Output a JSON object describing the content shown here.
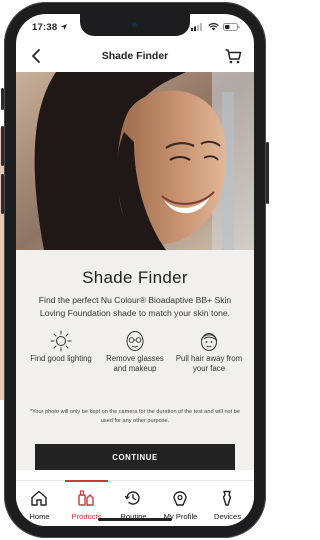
{
  "status_bar": {
    "time": "17:38",
    "location_icon": "location-arrow-icon",
    "signal_icon": "cellular-signal-icon",
    "wifi_icon": "wifi-icon",
    "battery_icon": "battery-icon"
  },
  "header": {
    "title": "Shade Finder",
    "back_icon": "back-chevron-icon",
    "cart_icon": "shopping-cart-icon"
  },
  "card": {
    "title": "Shade Finder",
    "description": "Find the perfect Nu Colour® Bioadaptive BB+ Skin Loving Foundation shade to match your skin tone.",
    "tips": [
      {
        "icon": "sun-icon",
        "label": "Find good lighting"
      },
      {
        "icon": "face-glasses-icon",
        "label": "Remove glasses and makeup"
      },
      {
        "icon": "face-hair-icon",
        "label": "Pull hair away from your face"
      }
    ],
    "privacy_note": "*Your photo will only be kept on the camera for the duration of the test and will not be used for any other purpose.",
    "cta_label": "CONTINUE"
  },
  "tab_bar": {
    "active_index": 1,
    "accent_color": "#d6323f",
    "tabs": [
      {
        "label": "Home",
        "icon": "home-icon"
      },
      {
        "label": "Products",
        "icon": "products-icon"
      },
      {
        "label": "Routine",
        "icon": "routine-clock-icon"
      },
      {
        "label": "My Profile",
        "icon": "profile-icon"
      },
      {
        "label": "Devices",
        "icon": "devices-icon"
      }
    ]
  }
}
